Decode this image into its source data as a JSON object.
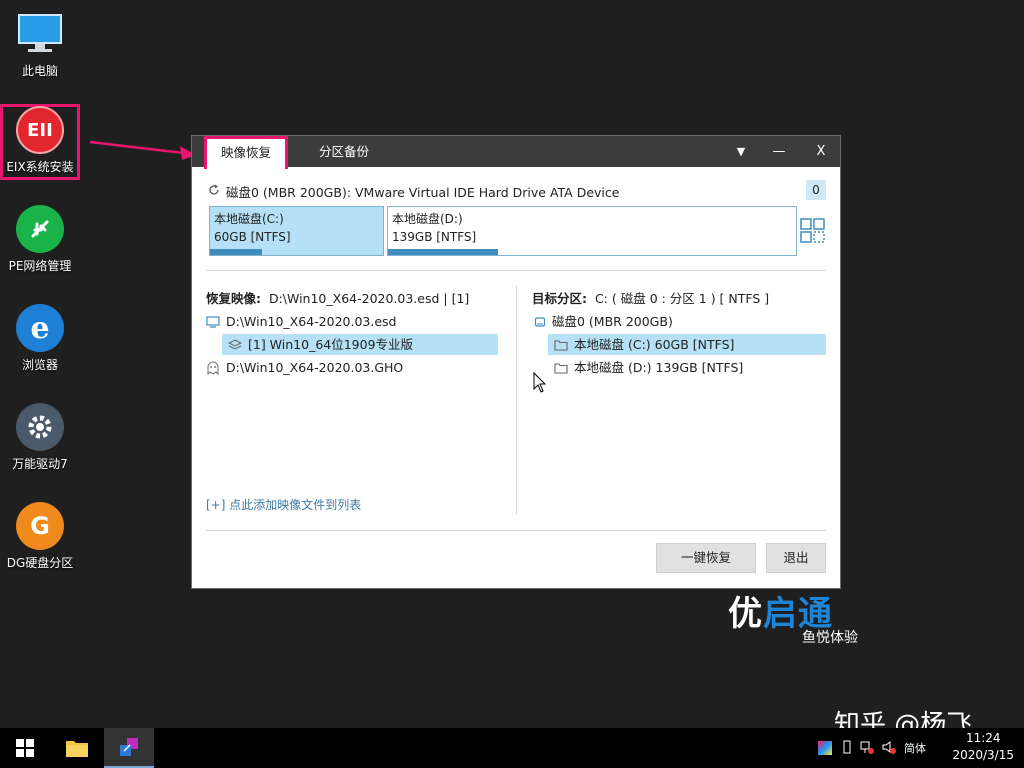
{
  "desktop": {
    "icons": [
      {
        "label": "此电脑"
      },
      {
        "label": "EIX系统安装",
        "glyph": "EII"
      },
      {
        "label": "PE网络管理"
      },
      {
        "label": "浏览器"
      },
      {
        "label": "万能驱动7"
      },
      {
        "label": "DG硬盘分区",
        "glyph": "G"
      }
    ]
  },
  "window": {
    "tabs": [
      {
        "label": "映像恢复"
      },
      {
        "label": "分区备份"
      }
    ],
    "controls": {
      "menu": "▼",
      "minimize": "—",
      "close": "X"
    },
    "disk_header": "磁盘0 (MBR 200GB): VMware Virtual IDE Hard Drive ATA Device",
    "disk_index": "0",
    "partitions": [
      {
        "name": "本地磁盘(C:)",
        "info": "60GB [NTFS]",
        "usage": 0.3
      },
      {
        "name": "本地磁盘(D:)",
        "info": "139GB [NTFS]",
        "usage": 0.27
      }
    ],
    "left": {
      "heading_label": "恢复映像:",
      "heading_value": "D:\\Win10_X64-2020.03.esd | [1]",
      "items": [
        "D:\\Win10_X64-2020.03.esd",
        "[1] Win10_64位1909专业版",
        "D:\\Win10_X64-2020.03.GHO"
      ],
      "add_link": "[+] 点此添加映像文件到列表"
    },
    "right": {
      "heading_label": "目标分区:",
      "heading_value": "C: ( 磁盘 0 : 分区 1 ) [ NTFS ]",
      "items": [
        "磁盘0 (MBR 200GB)",
        "本地磁盘 (C:) 60GB [NTFS]",
        "本地磁盘 (D:) 139GB [NTFS]"
      ]
    },
    "buttons": {
      "restore": "一键恢复",
      "exit": "退出"
    }
  },
  "watermark": {
    "logo_part1": "优",
    "logo_part2": "启通",
    "subtitle": "鱼悦体验",
    "zhihu": "知乎 @杨飞"
  },
  "taskbar": {
    "ime": "简体",
    "time": "11:24",
    "date": "2020/3/15"
  },
  "colors": {
    "accent": "#e8166d",
    "selection": "#b5e0f5",
    "bar": "#3e8dbc"
  }
}
